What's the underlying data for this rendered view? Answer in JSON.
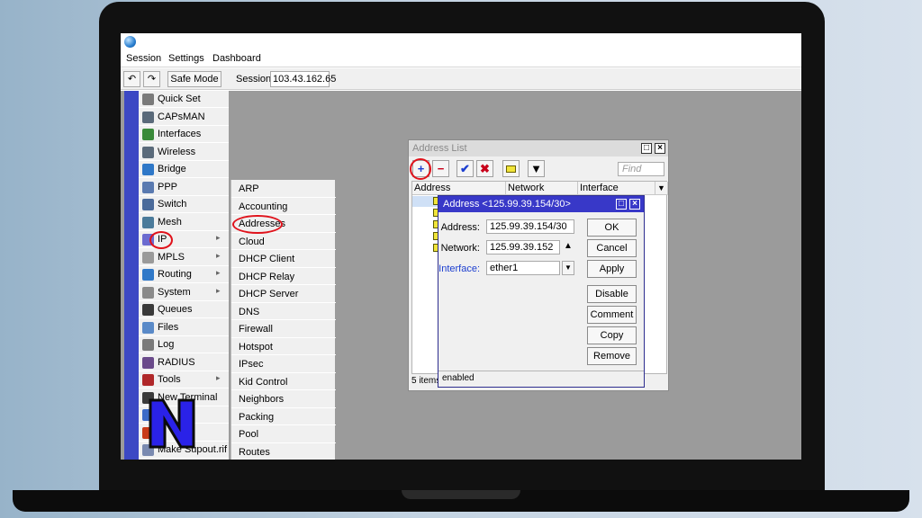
{
  "menu": {
    "session": "Session",
    "settings": "Settings",
    "dashboard": "Dashboard"
  },
  "toolbar": {
    "safe_mode": "Safe Mode",
    "session_label": "Session:",
    "session_value": "103.43.162.65"
  },
  "sidebar": [
    {
      "label": "Quick Set",
      "icon": "quick-set-icon"
    },
    {
      "label": "CAPsMAN",
      "icon": "capsman-icon"
    },
    {
      "label": "Interfaces",
      "icon": "interfaces-icon"
    },
    {
      "label": "Wireless",
      "icon": "wireless-icon"
    },
    {
      "label": "Bridge",
      "icon": "bridge-icon"
    },
    {
      "label": "PPP",
      "icon": "ppp-icon"
    },
    {
      "label": "Switch",
      "icon": "switch-icon"
    },
    {
      "label": "Mesh",
      "icon": "mesh-icon"
    },
    {
      "label": "IP",
      "icon": "ip-icon",
      "arrow": "▸"
    },
    {
      "label": "MPLS",
      "icon": "mpls-icon",
      "arrow": "▸"
    },
    {
      "label": "Routing",
      "icon": "routing-icon",
      "arrow": "▸"
    },
    {
      "label": "System",
      "icon": "system-icon",
      "arrow": "▸"
    },
    {
      "label": "Queues",
      "icon": "queues-icon"
    },
    {
      "label": "Files",
      "icon": "files-icon"
    },
    {
      "label": "Log",
      "icon": "log-icon"
    },
    {
      "label": "RADIUS",
      "icon": "radius-icon"
    },
    {
      "label": "Tools",
      "icon": "tools-icon",
      "arrow": "▸"
    },
    {
      "label": "New Terminal",
      "icon": "terminal-icon"
    },
    {
      "label": "",
      "icon": "windows-icon"
    },
    {
      "label": "",
      "icon": "exit-icon"
    },
    {
      "label": "Make Supout.rif",
      "icon": "supout-icon"
    }
  ],
  "ip_submenu": [
    "ARP",
    "Accounting",
    "Addresses",
    "Cloud",
    "DHCP Client",
    "DHCP Relay",
    "DHCP Server",
    "DNS",
    "Firewall",
    "Hotspot",
    "IPsec",
    "Kid Control",
    "Neighbors",
    "Packing",
    "Pool",
    "Routes"
  ],
  "address_list": {
    "title": "Address List",
    "find_placeholder": "Find",
    "columns": [
      "Address",
      "Network",
      "Interface"
    ],
    "status": "5 items"
  },
  "address_dialog": {
    "title": "Address <125.99.39.154/30>",
    "address_label": "Address:",
    "address_value": "125.99.39.154/30",
    "network_label": "Network:",
    "network_value": "125.99.39.152",
    "interface_label": "Interface:",
    "interface_value": "ether1",
    "buttons": {
      "ok": "OK",
      "cancel": "Cancel",
      "apply": "Apply",
      "disable": "Disable",
      "comment": "Comment",
      "copy": "Copy",
      "remove": "Remove"
    },
    "status": "enabled"
  },
  "colors": {
    "highlight": "#e0121b",
    "dialog_title": "#3838c8",
    "sidebar_strip": "#3c48c4",
    "workspace": "#9b9b9b"
  }
}
